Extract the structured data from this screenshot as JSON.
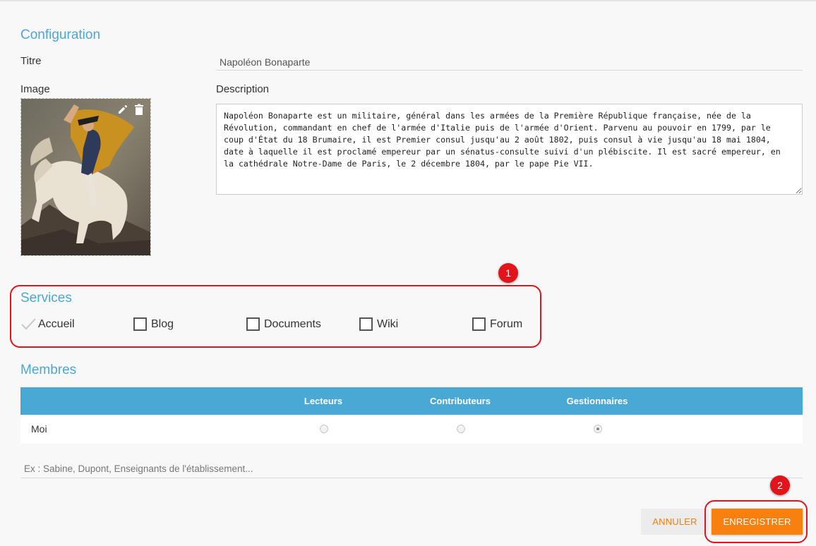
{
  "configuration": {
    "heading": "Configuration",
    "title_label": "Titre",
    "title_value": "Napoléon Bonaparte",
    "image_label": "Image",
    "image_edit_icon": "pencil-icon",
    "image_delete_icon": "trash-icon",
    "description_label": "Description",
    "description_value": "Napoléon Bonaparte est un militaire, général dans les armées de la Première République française, née de la Révolution, commandant en chef de l'armée d'Italie puis de l'armée d'Orient. Parvenu au pouvoir en 1799, par le coup d'État du 18 Brumaire, il est Premier consul jusqu'au 2 août 1802, puis consul à vie jusqu'au 18 mai 1804, date à laquelle il est proclamé empereur par un sénatus-consulte suivi d'un plébiscite. Il est sacré empereur, en la cathédrale Notre-Dame de Paris, le 2 décembre 1804, par le pape Pie VII."
  },
  "services": {
    "heading": "Services",
    "items": [
      {
        "label": "Accueil",
        "checked": true,
        "locked": true
      },
      {
        "label": "Blog",
        "checked": false
      },
      {
        "label": "Documents",
        "checked": false
      },
      {
        "label": "Wiki",
        "checked": false
      },
      {
        "label": "Forum",
        "checked": false
      }
    ]
  },
  "annotations": {
    "badge_1": "1",
    "badge_2": "2"
  },
  "members": {
    "heading": "Membres",
    "columns": [
      "",
      "Lecteurs",
      "Contributeurs",
      "Gestionnaires"
    ],
    "rows": [
      {
        "name": "Moi",
        "role": "Gestionnaires"
      }
    ],
    "search_placeholder": "Ex : Sabine, Dupont, Enseignants de l'établissement..."
  },
  "actions": {
    "cancel_label": "ANNULER",
    "save_label": "ENREGISTRER"
  },
  "colors": {
    "accent_blue": "#4aa9d4",
    "save_orange": "#f7800f",
    "annotation_red": "#e1141b"
  }
}
